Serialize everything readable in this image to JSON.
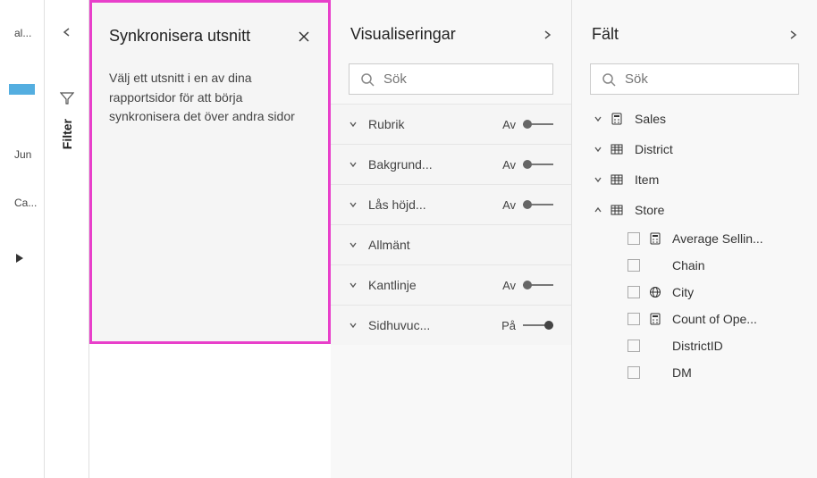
{
  "left": {
    "label1": "al...",
    "label2": "Jun",
    "label3": "Ca..."
  },
  "filter": {
    "label": "Filter"
  },
  "sync": {
    "title": "Synkronisera utsnitt",
    "body": "Välj ett utsnitt i en av dina rapportsidor för att börja synkronisera det över andra sidor"
  },
  "viz": {
    "title": "Visualiseringar",
    "search_placeholder": "Sök",
    "props": [
      {
        "label": "Rubrik",
        "state": "Av",
        "on": false
      },
      {
        "label": "Bakgrund...",
        "state": "Av",
        "on": false
      },
      {
        "label": "Lås höjd...",
        "state": "Av",
        "on": false
      },
      {
        "label": "Allmänt",
        "state": "",
        "on": null
      },
      {
        "label": "Kantlinje",
        "state": "Av",
        "on": false
      },
      {
        "label": "Sidhuvuc...",
        "state": "På",
        "on": true
      }
    ]
  },
  "fields": {
    "title": "Fält",
    "search_placeholder": "Sök",
    "tables": [
      {
        "name": "Sales",
        "expanded": false,
        "icon": "calc"
      },
      {
        "name": "District",
        "expanded": false,
        "icon": "table"
      },
      {
        "name": "Item",
        "expanded": false,
        "icon": "table"
      },
      {
        "name": "Store",
        "expanded": true,
        "icon": "table",
        "fields": [
          {
            "name": "Average Sellin...",
            "icon": "calc"
          },
          {
            "name": "Chain",
            "icon": ""
          },
          {
            "name": "City",
            "icon": "globe"
          },
          {
            "name": "Count of Ope...",
            "icon": "calc"
          },
          {
            "name": "DistrictID",
            "icon": ""
          },
          {
            "name": "DM",
            "icon": ""
          }
        ]
      }
    ]
  }
}
